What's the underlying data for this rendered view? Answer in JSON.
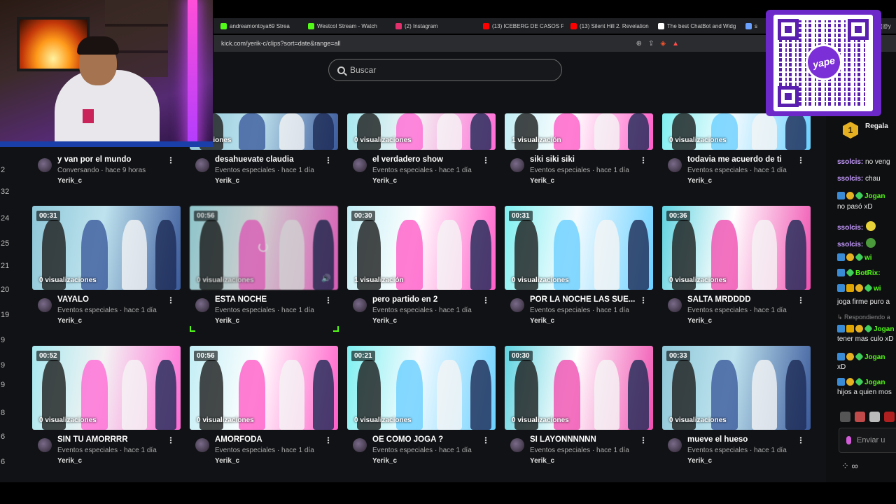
{
  "browser": {
    "tabs": [
      {
        "label": "andreamontoya69 Strea",
        "color": "#53fc18"
      },
      {
        "label": "Westcol Stream - Watch",
        "color": "#53fc18"
      },
      {
        "label": "(2) Instagram",
        "color": "#e1306c"
      },
      {
        "label": "(13) ICEBERG DE CASOS PE",
        "color": "#ff0000"
      },
      {
        "label": "(13) Silent Hill 2. Revelation",
        "color": "#ff0000"
      },
      {
        "label": "The best ChatBot and Widg",
        "color": "#ffffff"
      },
      {
        "label": "s",
        "color": "#6aa1ff"
      },
      {
        "label": "(@y",
        "color": "#9d7bff"
      }
    ],
    "url": "kick.com/yerik-c/clips?sort=date&range=all"
  },
  "search": {
    "placeholder": "Buscar"
  },
  "edge_numbers": [
    "2",
    "32",
    "24",
    "25",
    "21",
    "20",
    "19",
    "9",
    "9",
    "9",
    "8",
    "6",
    "6"
  ],
  "clips_row1": [
    {
      "views": "",
      "title": "y van por el mundo",
      "sub": "Conversando · hace 9 horas",
      "channel": "Yerik_c"
    },
    {
      "views": "ualizaciones",
      "title": "desahuevate claudia",
      "sub": "Eventos especiales · hace 1 día",
      "channel": "Yerik_c"
    },
    {
      "views": "0 visualizaciones",
      "title": "el verdadero show",
      "sub": "Eventos especiales · hace 1 día",
      "channel": "Yerik_c"
    },
    {
      "views": "1 visualización",
      "title": "siki siki siki",
      "sub": "Eventos especiales · hace 1 día",
      "channel": "Yerik_c"
    },
    {
      "views": "0 visualizaciones",
      "title": "todavia me acuerdo de ti",
      "sub": "Eventos especiales · hace 1 día",
      "channel": "Yerik_c"
    }
  ],
  "clips_row2": [
    {
      "duration": "00:31",
      "views": "0 visualizaciones",
      "title": "VAYALO",
      "sub": "Eventos especiales · hace 1 día",
      "channel": "Yerik_c"
    },
    {
      "duration": "00:56",
      "views": "0 visualizaciones",
      "title": "ESTA NOCHE",
      "sub": "Eventos especiales · hace 1 día",
      "channel": "Yerik_c"
    },
    {
      "duration": "00:30",
      "views": "1 visualización",
      "title": "pero partido en 2",
      "sub": "Eventos especiales · hace 1 día",
      "channel": "Yerik_c"
    },
    {
      "duration": "00:31",
      "views": "0 visualizaciones",
      "title": "POR LA NOCHE LAS SUE...",
      "sub": "Eventos especiales · hace 1 día",
      "channel": "Yerik_c"
    },
    {
      "duration": "00:36",
      "views": "0 visualizaciones",
      "title": "SALTA MRDDDD",
      "sub": "Eventos especiales · hace 1 día",
      "channel": "Yerik_c"
    }
  ],
  "clips_row3": [
    {
      "duration": "00:52",
      "views": "0 visualizaciones",
      "title": "SIN TU AMORRRR",
      "sub": "Eventos especiales · hace 1 día",
      "channel": "Yerik_c"
    },
    {
      "duration": "00:56",
      "views": "0 visualizaciones",
      "title": "AMORFODA",
      "sub": "Eventos especiales · hace 1 día",
      "channel": "Yerik_c"
    },
    {
      "duration": "00:21",
      "views": "0 visualizaciones",
      "title": "OE COMO JOGA ?",
      "sub": "Eventos especiales · hace 1 día",
      "channel": "Yerik_c"
    },
    {
      "duration": "00:30",
      "views": "0 visualizaciones",
      "title": "SI LAYONNNNNN",
      "sub": "Eventos especiales · hace 1 día",
      "channel": "Yerik_c"
    },
    {
      "duration": "00:33",
      "views": "0 visualizaciones",
      "title": "mueve el hueso",
      "sub": "Eventos especiales · hace 1 día",
      "channel": "Yerik_c"
    }
  ],
  "chat": {
    "gift_count": "1",
    "gift_label": "Regala",
    "messages": [
      {
        "user": "ssolcis:",
        "text": " no veng",
        "badges": []
      },
      {
        "user": "ssolcis:",
        "text": " chau",
        "badges": []
      },
      {
        "user": "Jogan",
        "text": "",
        "badges": [
          "blue",
          "gold",
          "green"
        ]
      },
      {
        "user": "",
        "text": "no pasó xD",
        "badges": []
      },
      {
        "user": "ssolcis:",
        "text": "",
        "badges": [],
        "emote": "#e8d23a"
      },
      {
        "user": "ssolcis:",
        "text": "",
        "badges": [],
        "emote": "#4b9a3c"
      },
      {
        "user": "wi",
        "text": "",
        "badges": [
          "blue",
          "gold",
          "green"
        ]
      },
      {
        "user": "BotRix:",
        "text": "",
        "badges": [
          "blue",
          "green"
        ]
      },
      {
        "user": "wi",
        "text": "",
        "badges": [
          "blue",
          "crown",
          "gold",
          "green"
        ]
      },
      {
        "user": "",
        "text": "joga firme puro a",
        "badges": []
      },
      {
        "user": "",
        "text": "↳ Respondiendo a",
        "badges": [],
        "reply": true
      },
      {
        "user": "Jogan",
        "text": "",
        "badges": [
          "blue",
          "crown",
          "gold",
          "green"
        ]
      },
      {
        "user": "",
        "text": "tener mas culo xD",
        "badges": []
      },
      {
        "user": "Jogan",
        "text": "",
        "badges": [
          "blue",
          "gold",
          "green"
        ]
      },
      {
        "user": "",
        "text": "xD",
        "badges": []
      },
      {
        "user": "Jogan",
        "text": "",
        "badges": [
          "blue",
          "gold",
          "green"
        ]
      },
      {
        "user": "",
        "text": "hijos a quien mos",
        "badges": []
      }
    ],
    "input_placeholder": "Enviar u",
    "footer_icon": "∞"
  },
  "qr": {
    "logo_text": "yape",
    "color": "#6d28c9"
  },
  "colors": {
    "kick_green": "#53fc18",
    "background": "#111215"
  }
}
